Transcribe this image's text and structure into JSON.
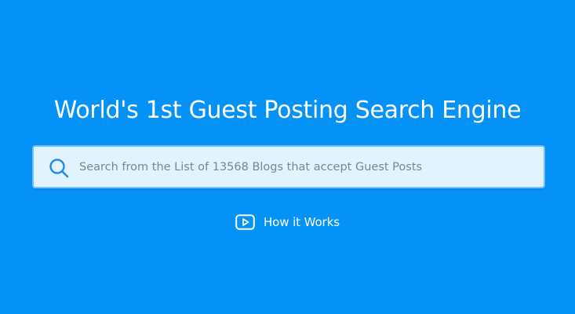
{
  "hero": {
    "headline": "World's 1st Guest Posting Search Engine"
  },
  "search": {
    "placeholder": "Search from the List of 13568 Blogs that accept Guest Posts",
    "value": "",
    "icon": "search-icon"
  },
  "how_it_works": {
    "label": "How it Works",
    "icon": "play-icon"
  },
  "colors": {
    "background": "#0592f7",
    "search_background": "#e1f3fe",
    "search_border": "#6fc2fb",
    "icon_accent": "#1e8de6",
    "text_light": "#ffffff"
  }
}
